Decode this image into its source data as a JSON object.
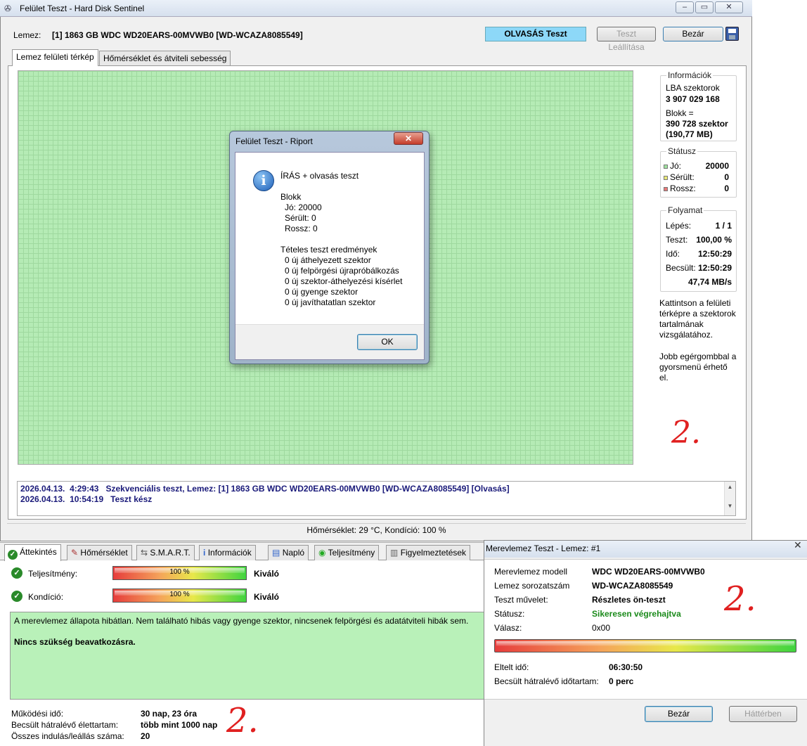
{
  "main_window": {
    "title": "Felület Teszt - Hard Disk Sentinel",
    "disk_label": "Lemez:",
    "disk_value": "[1] 1863 GB  WDC WD20EARS-00MVWB0 [WD-WCAZA8085549]",
    "read_test_label": "OLVASÁS Teszt",
    "stop_label": "Teszt Leállítása",
    "close_label": "Bezár",
    "tabs": [
      "Lemez felületi térkép",
      "Hőmérséklet és átviteli sebesség"
    ],
    "info": {
      "title": "Információk",
      "lba_label": "LBA szektorok",
      "lba_value": "3 907 029 168",
      "block_label": "Blokk =",
      "block_value1": "390 728 szektor",
      "block_value2": "(190,77 MB)"
    },
    "status": {
      "title": "Státusz",
      "good_label": "Jó:",
      "good_value": "20000",
      "damaged_label": "Sérült:",
      "damaged_value": "0",
      "bad_label": "Rossz:",
      "bad_value": "0",
      "colors": {
        "good": "#9fe29f",
        "damaged": "#e8e878",
        "bad": "#e87878"
      }
    },
    "progress": {
      "title": "Folyamat",
      "step_label": "Lépés:",
      "step_value": "1 / 1",
      "test_label": "Teszt:",
      "test_value": "100,00 %",
      "time_label": "Idő:",
      "time_value": "12:50:29",
      "est_label": "Becsült:",
      "est_value": "12:50:29",
      "speed": "47,74 MB/s"
    },
    "hint1": "Kattintson a felületi térképre a szektorok tartalmának vizsgálatához.",
    "hint2": "Jobb egérgombbal a gyorsmenü érhető el.",
    "log": [
      {
        "date": "2026.04.13.",
        "time": "4:29:43",
        "msg": "Szekvenciális teszt, Lemez: [1] 1863 GB  WDC WD20EARS-00MVWB0 [WD-WCAZA8085549] [Olvasás]"
      },
      {
        "date": "2026.04.13.",
        "time": "10:54:19",
        "msg": "Teszt kész"
      }
    ],
    "statusbar": "Hőmérséklet: 29  °C,  Kondíció: 100 %"
  },
  "report_dialog": {
    "title": "Felület Teszt - Riport",
    "heading": "ÍRÁS + olvasás teszt",
    "block_title": "Blokk",
    "good": "Jó: 20000",
    "damaged": "Sérült: 0",
    "bad": "Rossz: 0",
    "results_title": "Tételes teszt eredmények",
    "results": [
      "0 új áthelyezett szektor",
      "0 új felpörgési újrapróbálkozás",
      "0 új szektor-áthelyezési kísérlet",
      "0 új gyenge szektor",
      "0 új javíthatatlan szektor"
    ],
    "ok_label": "OK"
  },
  "overview_panel": {
    "tabs": [
      "Áttekintés",
      "Hőmérséklet",
      "S.M.A.R.T.",
      "Információk",
      "Napló",
      "Teljesítmény",
      "Figyelmeztetések"
    ],
    "performance_label": "Teljesítmény:",
    "performance_pct": "100 %",
    "performance_fraction": 1.0,
    "performance_rating": "Kiváló",
    "condition_label": "Kondíció:",
    "condition_pct": "100 %",
    "condition_fraction": 1.0,
    "condition_rating": "Kiváló",
    "message": "A merevlemez állapota hibátlan. Nem található hibás vagy gyenge szektor, nincsenek felpörgési és adatátviteli hibák sem.",
    "message_bold": "Nincs szükség beavatkozásra.",
    "uptime_label": "Működési idő:",
    "uptime_value": "30 nap, 23 óra",
    "lifetime_label": "Becsült hátralévő élettartam:",
    "lifetime_value": "több mint 1000 nap",
    "starts_label": "Összes indulás/leállás száma:",
    "starts_value": "20"
  },
  "selftest_window": {
    "title": "Merevlemez Teszt - Lemez: #1",
    "model_label": "Merevlemez modell",
    "model_value": "WDC WD20EARS-00MVWB0",
    "serial_label": "Lemez sorozatszám",
    "serial_value": "WD-WCAZA8085549",
    "op_label": "Teszt művelet:",
    "op_value": "Részletes ön-teszt",
    "status_label": "Státusz:",
    "status_value": "Sikeresen végrehajtva",
    "reply_label": "Válasz:",
    "reply_value": "0x00",
    "progress_fraction": 1.0,
    "elapsed_label": "Eltelt idő:",
    "elapsed_value": "06:30:50",
    "remaining_label": "Becsült hátralévő időtartam:",
    "remaining_value": "0 perc",
    "close_label": "Bezár",
    "background_label": "Háttérben",
    "status_color": "#1a8a1a"
  },
  "annotations": [
    "2.",
    "2.",
    "2."
  ]
}
